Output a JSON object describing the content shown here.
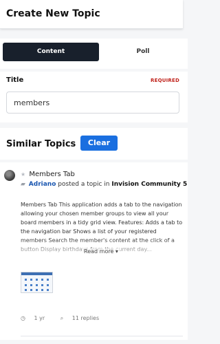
{
  "header": {
    "title": "Create New Topic"
  },
  "tabs": [
    {
      "label": "Content",
      "active": true
    },
    {
      "label": "Poll",
      "active": false
    }
  ],
  "title_field": {
    "label": "Title",
    "required": "REQUIRED",
    "value": "members"
  },
  "similar": {
    "heading": "Similar Topics",
    "clear_label": "Clear"
  },
  "result": {
    "title": "Members Tab",
    "author": "Adriano",
    "action": "posted a topic in",
    "forum": "Invision Community 5",
    "excerpt": "Members Tab This application adds a tab to the navigation allowing your chosen member groups to view all your board members in a tidy grid view. Features: Adds a tab to the navigation bar Shows a list of your registered members Search the member's content at the click of a button Display birthdays from the current day...",
    "read_more": "Read more",
    "time": "1 yr",
    "replies": "11 replies"
  },
  "colors": {
    "primary": "#1a6fe0",
    "dark_tab": "#18202c",
    "required": "#c0221b",
    "link": "#1a56b0"
  }
}
